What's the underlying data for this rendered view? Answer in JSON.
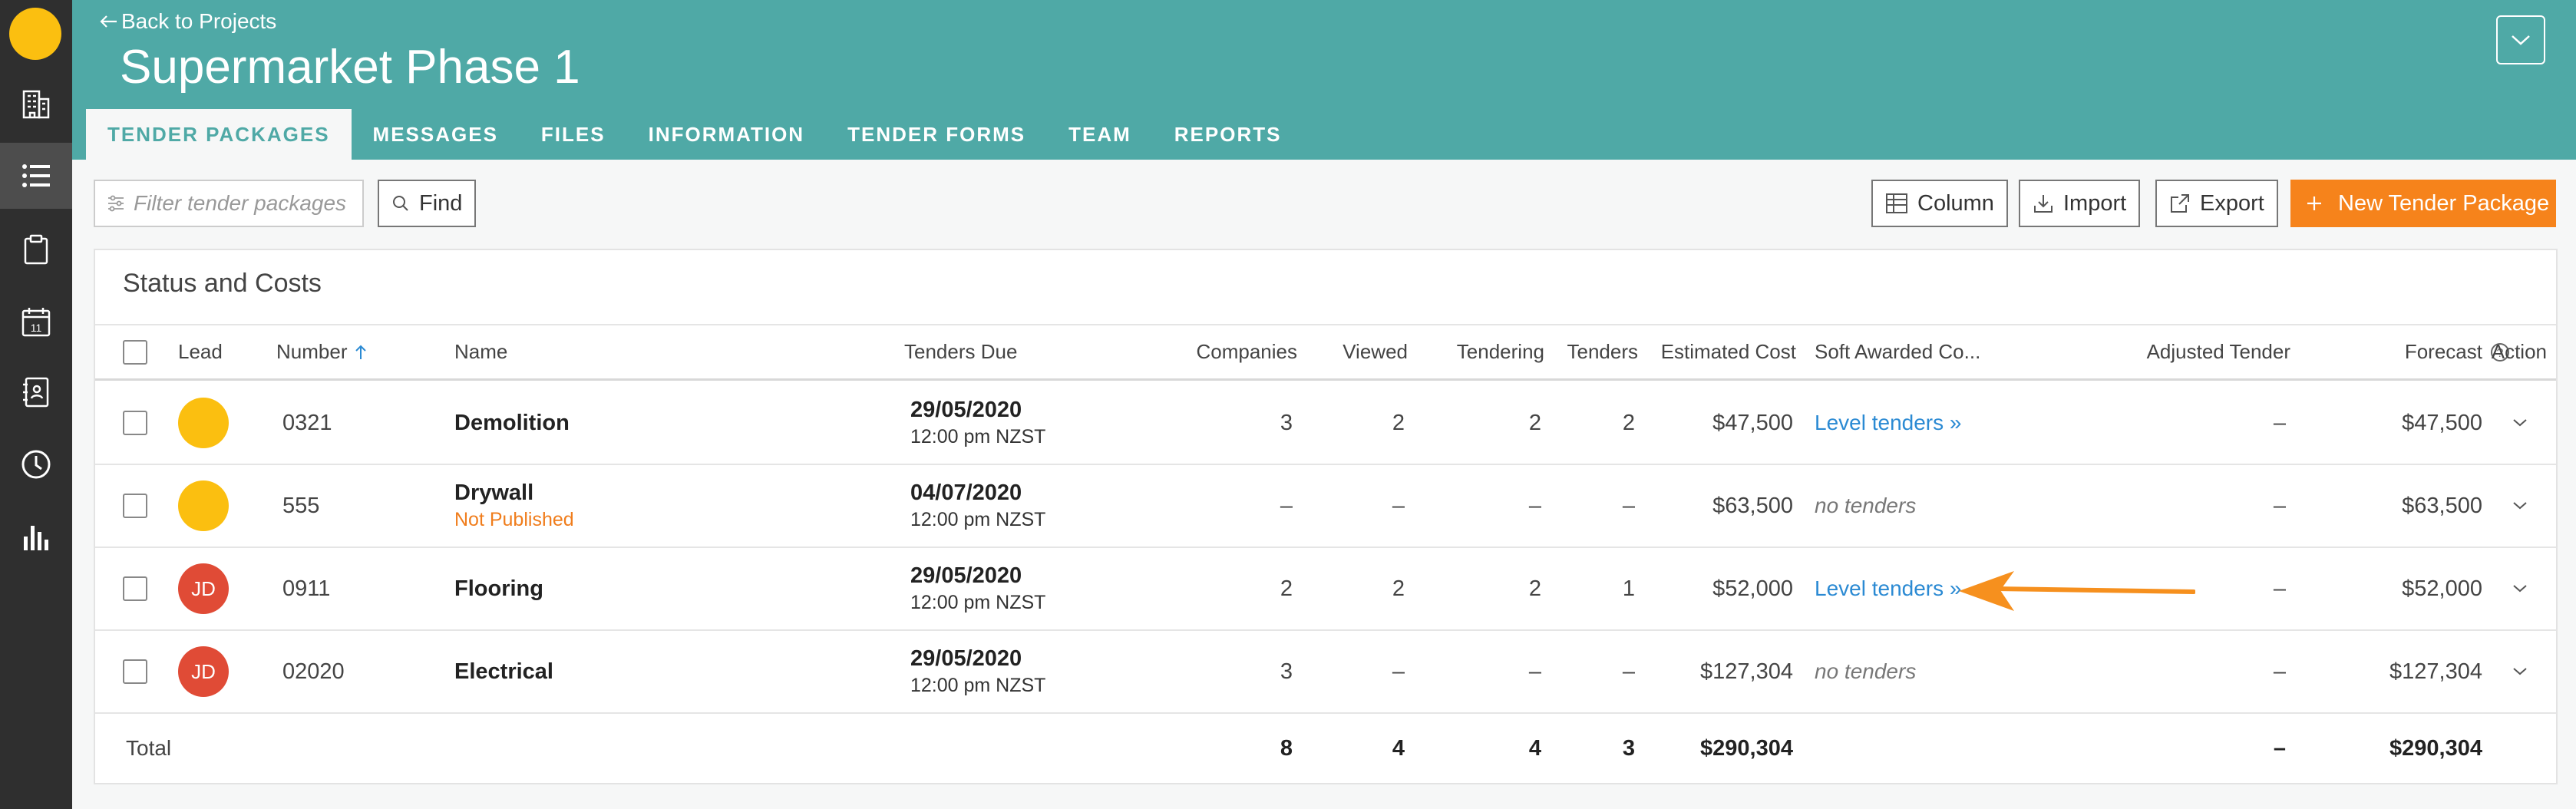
{
  "sidebar": {
    "icons": [
      "building-icon",
      "list-icon",
      "clipboard-icon",
      "calendar-icon",
      "contacts-book-icon",
      "clock-icon",
      "bar-chart-icon"
    ],
    "calendar_day": "11"
  },
  "header": {
    "back_link": "Back to Projects",
    "title": "Supermarket Phase 1",
    "tabs": [
      {
        "label": "TENDER PACKAGES"
      },
      {
        "label": "MESSAGES"
      },
      {
        "label": "FILES"
      },
      {
        "label": "INFORMATION"
      },
      {
        "label": "TENDER FORMS"
      },
      {
        "label": "TEAM"
      },
      {
        "label": "REPORTS"
      }
    ]
  },
  "toolbar": {
    "filter_placeholder": "Filter tender packages",
    "find_label": "Find",
    "column_label": "Column",
    "import_label": "Import",
    "export_label": "Export",
    "new_package_label": "New Tender Package"
  },
  "card": {
    "title": "Status and Costs",
    "columns": {
      "lead": "Lead",
      "number": "Number",
      "name": "Name",
      "due": "Tenders Due",
      "companies": "Companies",
      "viewed": "Viewed",
      "tendering": "Tendering",
      "tenders": "Tenders",
      "estimated": "Estimated Cost",
      "soft_awarded": "Soft Awarded Co...",
      "adjusted": "Adjusted Tender",
      "forecast": "Forecast",
      "action": "Action"
    },
    "rows": [
      {
        "lead": "",
        "number": "0321",
        "name": "Demolition",
        "status": "",
        "due_date": "29/05/2020",
        "due_time": "12:00 pm NZST",
        "companies": "3",
        "viewed": "2",
        "tendering": "2",
        "tenders": "2",
        "estimated": "$47,500",
        "soft_awarded": "Level tenders »",
        "adjusted": "–",
        "forecast": "$47,500"
      },
      {
        "lead": "",
        "number": "555",
        "name": "Drywall",
        "status": "Not Published",
        "due_date": "04/07/2020",
        "due_time": "12:00 pm NZST",
        "companies": "–",
        "viewed": "–",
        "tendering": "–",
        "tenders": "–",
        "estimated": "$63,500",
        "soft_awarded": "no tenders",
        "adjusted": "–",
        "forecast": "$63,500"
      },
      {
        "lead": "JD",
        "number": "0911",
        "name": "Flooring",
        "status": "",
        "due_date": "29/05/2020",
        "due_time": "12:00 pm NZST",
        "companies": "2",
        "viewed": "2",
        "tendering": "2",
        "tenders": "1",
        "estimated": "$52,000",
        "soft_awarded": "Level tenders »",
        "adjusted": "–",
        "forecast": "$52,000"
      },
      {
        "lead": "JD",
        "number": "02020",
        "name": "Electrical",
        "status": "",
        "due_date": "29/05/2020",
        "due_time": "12:00 pm NZST",
        "companies": "3",
        "viewed": "–",
        "tendering": "–",
        "tenders": "–",
        "estimated": "$127,304",
        "soft_awarded": "no tenders",
        "adjusted": "–",
        "forecast": "$127,304"
      }
    ],
    "total": {
      "label": "Total",
      "companies": "8",
      "viewed": "4",
      "tendering": "4",
      "tenders": "3",
      "estimated": "$290,304",
      "adjusted": "–",
      "forecast": "$290,304"
    }
  },
  "colors": {
    "header_teal": "#4fa9a6",
    "sidebar_dark": "#2f2f2f",
    "primary_orange": "#f6831b",
    "link_blue": "#2b8ad3",
    "avatar_yellow": "#fbbf10",
    "avatar_red": "#e04b36",
    "annotation_arrow": "#f6901e"
  }
}
